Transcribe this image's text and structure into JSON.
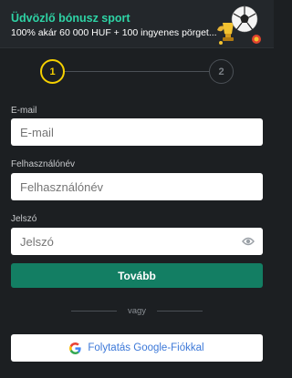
{
  "banner": {
    "title": "Üdvözlő bónusz sport",
    "subtitle": "100% akár 60 000 HUF + 100 ingyenes pörget..."
  },
  "stepper": {
    "step1": "1",
    "step2": "2",
    "current": 1
  },
  "form": {
    "email": {
      "label": "E-mail",
      "placeholder": "E-mail"
    },
    "username": {
      "label": "Felhasználónév",
      "placeholder": "Felhasználónév"
    },
    "password": {
      "label": "Jelszó",
      "placeholder": "Jelszó"
    },
    "continue_label": "Tovább"
  },
  "divider": {
    "text": "vagy"
  },
  "google": {
    "label": "Folytatás Google-Fiókkal",
    "icon": "google-icon"
  },
  "colors": {
    "background": "#1c1f22",
    "accent_title": "#2ed3a5",
    "primary_button": "#137e63",
    "step_active": "#f5d000",
    "google_text": "#3c78d8"
  }
}
